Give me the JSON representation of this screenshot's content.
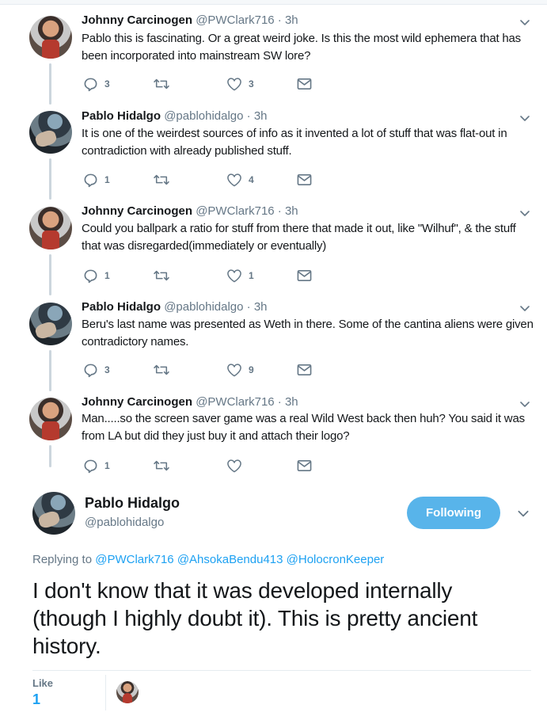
{
  "replies": [
    {
      "name": "Johnny Carcinogen",
      "handle": "@PWClark716",
      "dot": "·",
      "time": "3h",
      "avatar": "johnny",
      "text": "Pablo this is fascinating. Or a great weird joke. Is this the most wild ephemera that has been incorporated into mainstream SW lore?",
      "reply_count": "3",
      "retweet_count": "",
      "like_count": "3"
    },
    {
      "name": "Pablo Hidalgo",
      "handle": "@pablohidalgo",
      "dot": "·",
      "time": "3h",
      "avatar": "pablo",
      "text": "It is one of the weirdest sources of info as it invented a lot of stuff that was flat-out in contradiction with already published stuff.",
      "reply_count": "1",
      "retweet_count": "",
      "like_count": "4"
    },
    {
      "name": "Johnny Carcinogen",
      "handle": "@PWClark716",
      "dot": "·",
      "time": "3h",
      "avatar": "johnny",
      "text": "Could you ballpark a ratio for stuff from there that made it out, like \"Wilhuf\", & the stuff that was disregarded(immediately or eventually)",
      "reply_count": "1",
      "retweet_count": "",
      "like_count": "1"
    },
    {
      "name": "Pablo Hidalgo",
      "handle": "@pablohidalgo",
      "dot": "·",
      "time": "3h",
      "avatar": "pablo",
      "text": "Beru's last name was presented as Weth in there. Some of the cantina aliens were given contradictory names.",
      "reply_count": "3",
      "retweet_count": "",
      "like_count": "9"
    },
    {
      "name": "Johnny Carcinogen",
      "handle": "@PWClark716",
      "dot": "·",
      "time": "3h",
      "avatar": "johnny",
      "text": "Man.....so the screen saver game was a real Wild West back then huh? You said it was from LA but did they just buy it and attach their logo?",
      "reply_count": "1",
      "retweet_count": "",
      "like_count": ""
    }
  ],
  "main_tweet": {
    "name": "Pablo Hidalgo",
    "handle": "@pablohidalgo",
    "follow_label": "Following",
    "replying_prefix": "Replying to",
    "mentions": [
      "@PWClark716",
      "@AhsokaBendu413",
      "@HolocronKeeper"
    ],
    "text": "I don't know that it was developed internally (though I highly doubt it). This is pretty ancient history.",
    "like_label": "Like",
    "like_count": "1"
  },
  "icons": {
    "reply": "reply-icon",
    "retweet": "retweet-icon",
    "like": "heart-icon",
    "dm": "envelope-icon",
    "caret": "chevron-down-icon"
  },
  "colors": {
    "accent": "#1da1f2",
    "follow_button": "#58b4ea",
    "muted": "#657786",
    "text": "#14171a"
  }
}
